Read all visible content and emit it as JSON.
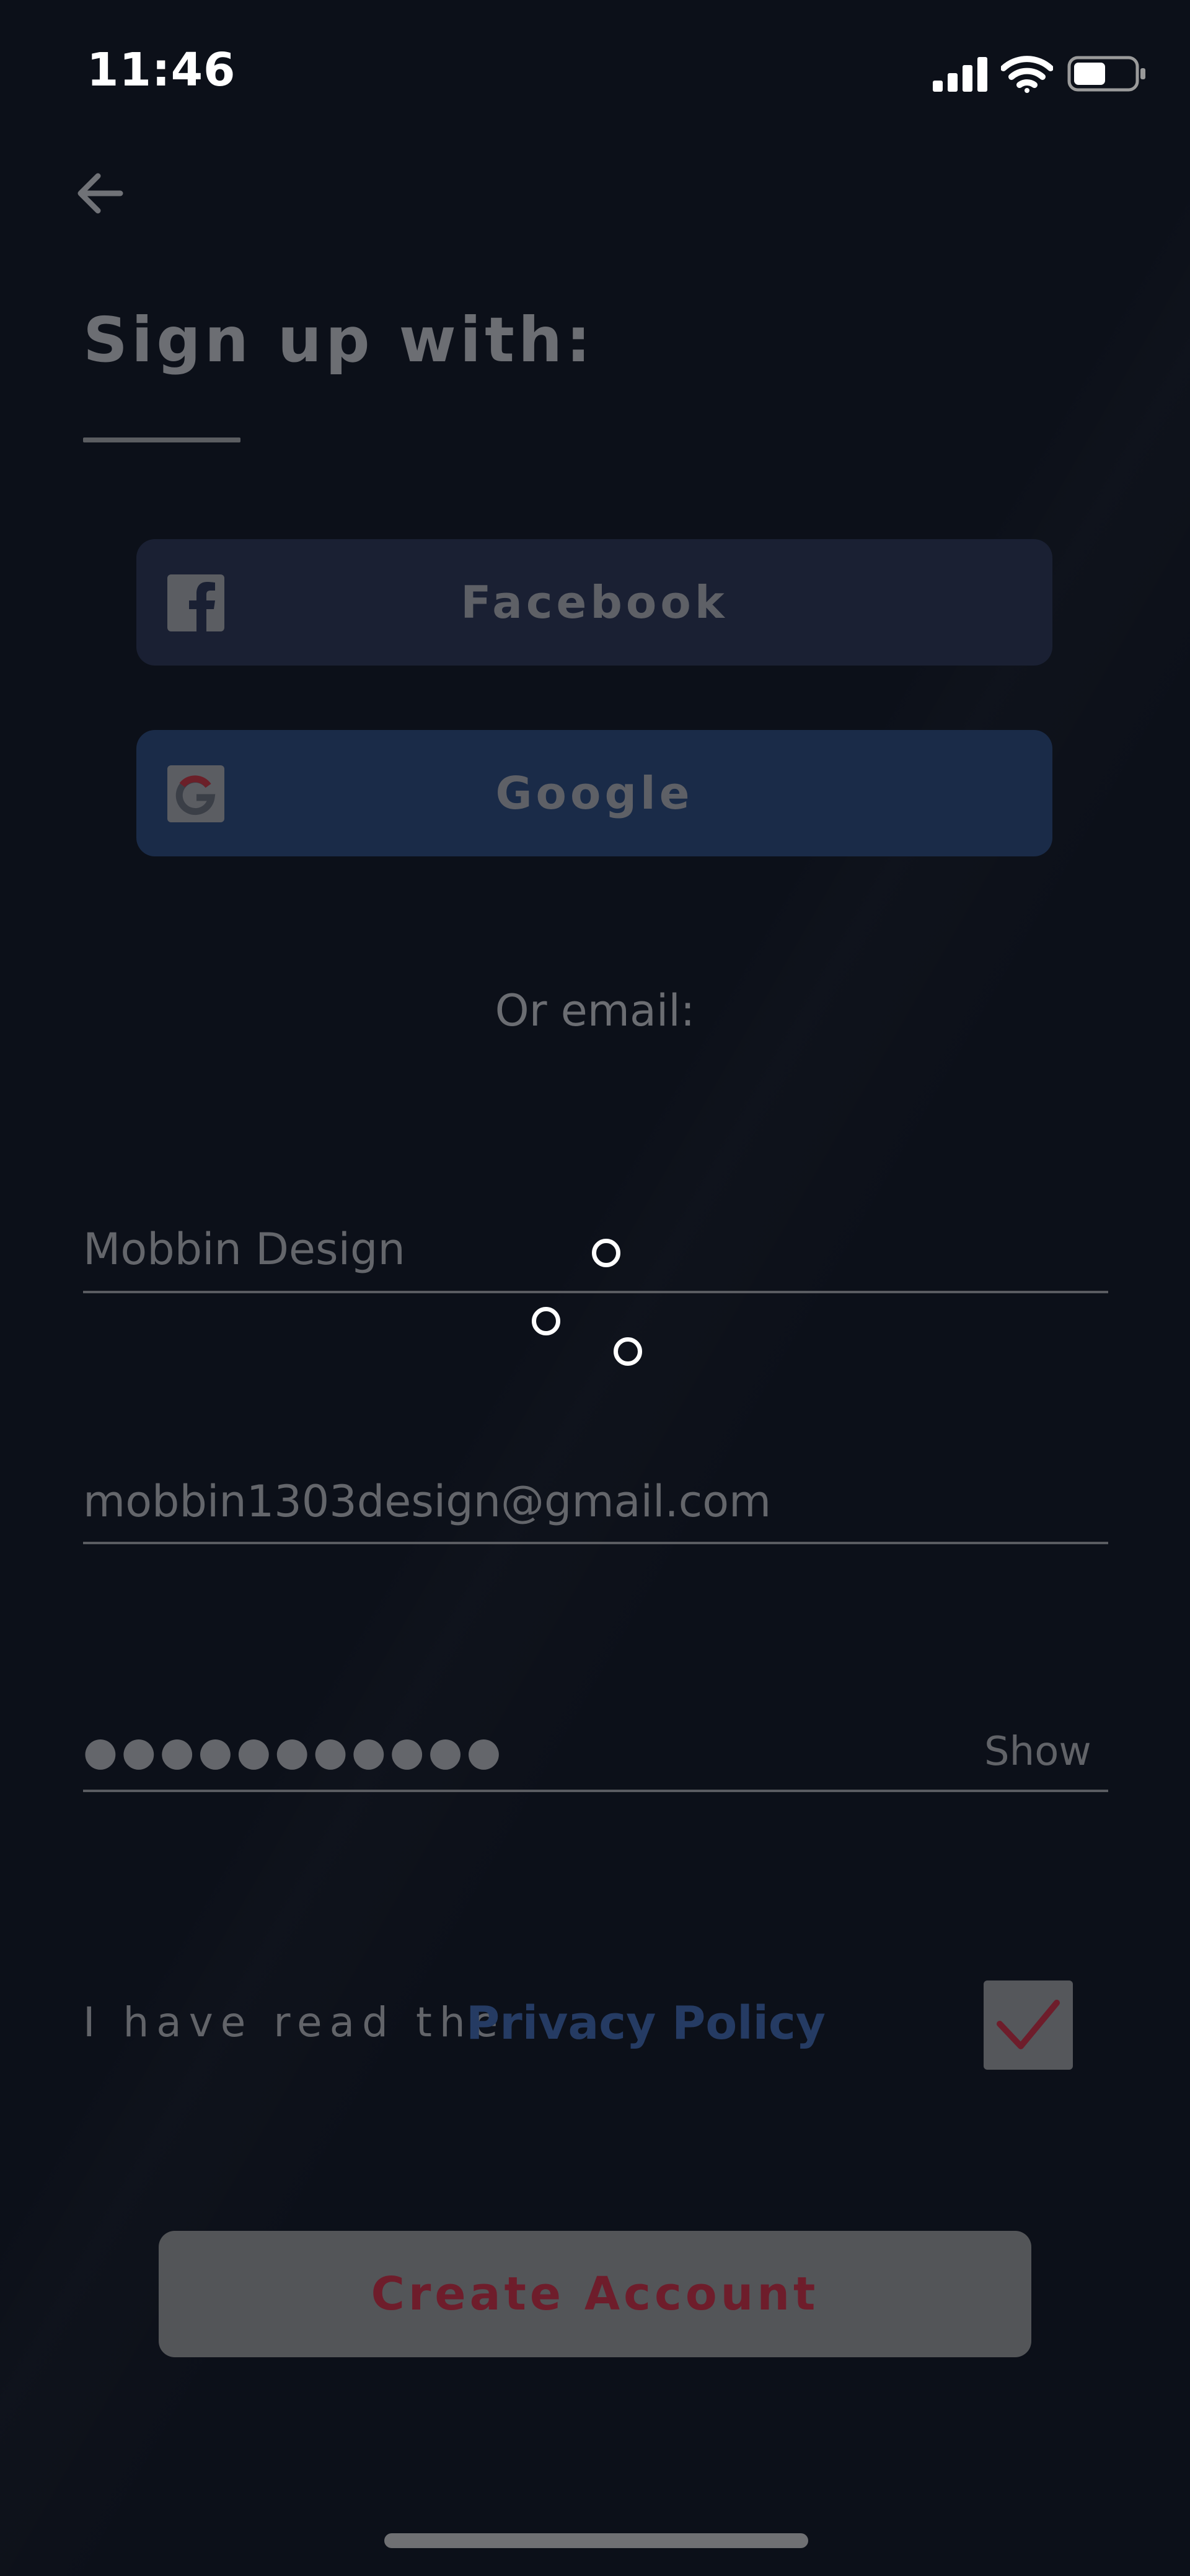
{
  "status_bar": {
    "time": "11:46"
  },
  "header": {
    "title": "Sign up with:"
  },
  "social": {
    "facebook_label": "Facebook",
    "google_label": "Google"
  },
  "divider_text": "Or email:",
  "form": {
    "name_value": "Mobbin Design",
    "email_value": "mobbin1303design@gmail.com",
    "password_mask": "●●●●●●●●●●●",
    "show_label": "Show",
    "privacy_prefix": "I have read the",
    "privacy_link": "Privacy Policy",
    "privacy_checked": true
  },
  "actions": {
    "create_label": "Create Account"
  },
  "colors": {
    "background": "#0c1019",
    "facebook_button": "#1a2033",
    "google_button": "#1a2b48",
    "link": "#253b63",
    "accent_red": "#6e1d2b"
  },
  "icons": {
    "back": "arrow-left-icon",
    "facebook": "facebook-icon",
    "google": "google-icon",
    "signal": "cellular-signal-icon",
    "wifi": "wifi-icon",
    "battery": "battery-icon",
    "check": "checkmark-icon"
  }
}
